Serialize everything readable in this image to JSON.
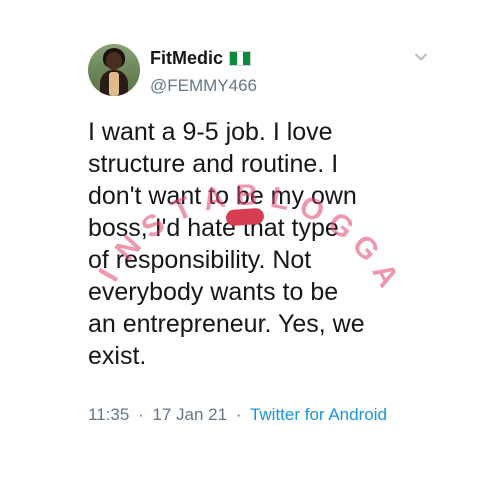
{
  "tweet": {
    "display_name": "FitMedic",
    "flag_icon": "nigeria-flag-icon",
    "handle": "@FEMMY466",
    "text_lines": [
      "I want a 9-5 job. I love",
      "structure and routine. I",
      "don't want to be my own",
      "boss, I'd hate that type",
      "of responsibility. Not",
      "everybody wants to be",
      "an entrepreneur. Yes, we",
      "exist."
    ],
    "time": "11:35",
    "separator": "·",
    "date": "17 Jan 21",
    "source": "Twitter for Android"
  },
  "watermark": {
    "text": "INSTABLOGGA",
    "color": "#e0436a"
  },
  "colors": {
    "text": "#14171a",
    "secondary": "#657786",
    "link": "#1b95e0",
    "flag_green": "#0b8a3d"
  }
}
